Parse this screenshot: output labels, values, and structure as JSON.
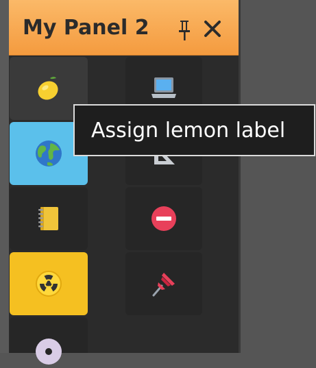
{
  "panel": {
    "title": "My Panel 2",
    "header_color": "#f6a34a",
    "pin_icon": "pin-icon",
    "close_icon": "close-icon"
  },
  "buttons": [
    {
      "icon": "lemon-icon",
      "bg": "#3a3a3a",
      "selected": false
    },
    {
      "icon": "globe-icon",
      "bg": "#5bc0eb",
      "selected": true
    },
    {
      "icon": "notebook-icon",
      "bg": "#262626",
      "selected": false
    },
    {
      "icon": "radioactive-icon",
      "bg": "#f5c021",
      "selected": true
    },
    {
      "icon": "disc-icon",
      "bg": "#262626",
      "selected": false
    },
    {
      "icon": "laptop-icon",
      "bg": "#262626",
      "selected": false
    },
    {
      "icon": "triangle-ruler-icon",
      "bg": "#262626",
      "selected": false
    },
    {
      "icon": "no-entry-icon",
      "bg": "#262626",
      "selected": false
    },
    {
      "icon": "pushpin-icon",
      "bg": "#262626",
      "selected": false
    }
  ],
  "tooltip": {
    "text": "Assign lemon label"
  }
}
